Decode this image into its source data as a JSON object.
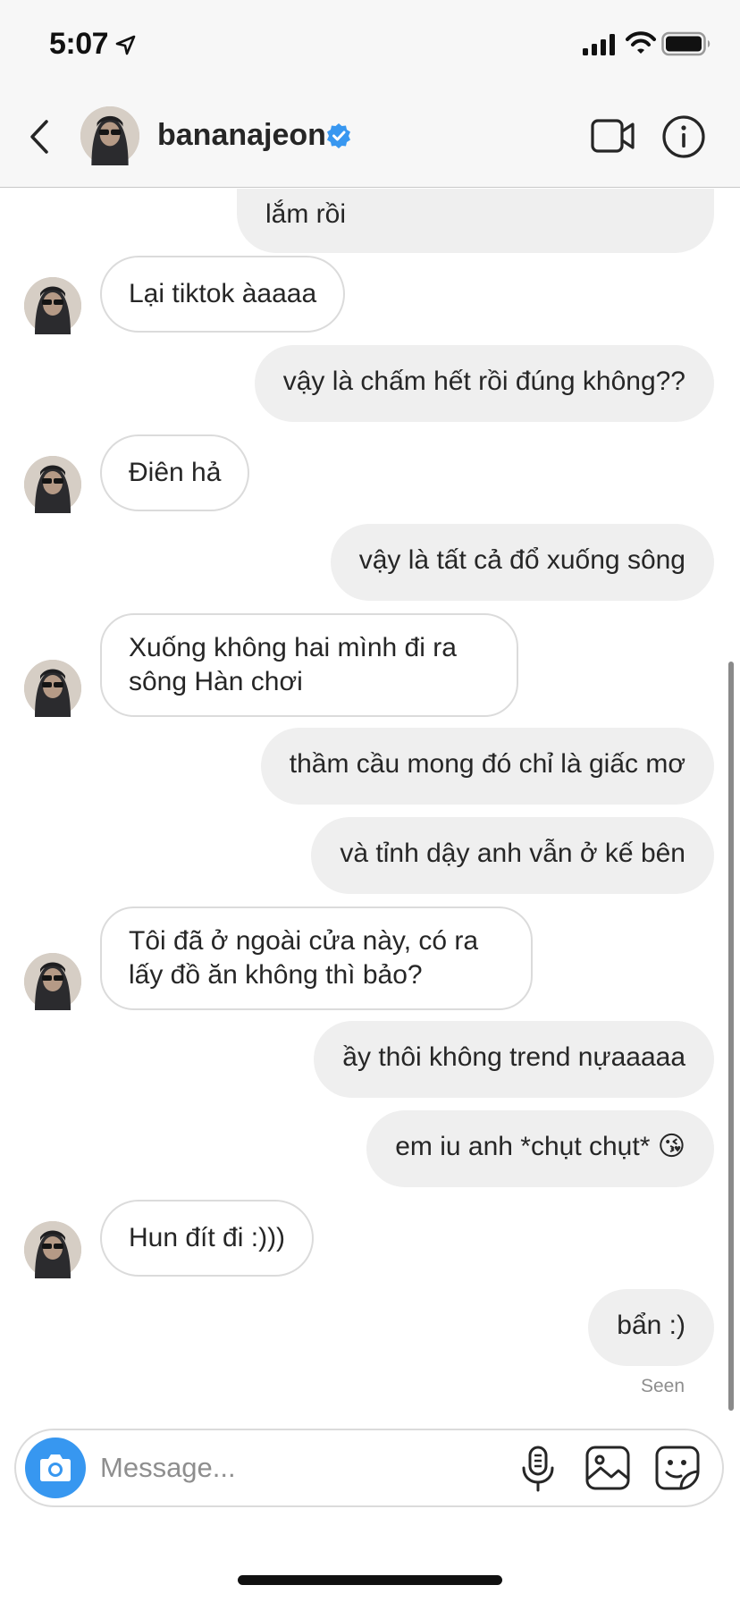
{
  "status_bar": {
    "time": "5:07"
  },
  "header": {
    "username": "bananajeon",
    "verified": true
  },
  "messages": [
    {
      "side": "sent",
      "text": "lắm rồi"
    },
    {
      "side": "received",
      "text": "Lại tiktok àaaaa"
    },
    {
      "side": "sent",
      "text": "vậy là chấm hết rồi đúng không??"
    },
    {
      "side": "received",
      "text": "Điên hả"
    },
    {
      "side": "sent",
      "text": "vậy là tất cả đổ xuống sông"
    },
    {
      "side": "received",
      "line1": "Xuống không hai mình đi ra",
      "line2": "sông Hàn chơi"
    },
    {
      "side": "sent",
      "text": "thầm cầu mong đó chỉ là giấc mơ"
    },
    {
      "side": "sent",
      "text": "và tỉnh dậy anh vẫn ở kế bên"
    },
    {
      "side": "received",
      "line1": "Tôi đã ở ngoài cửa này, có ra",
      "line2": "lấy đồ ăn không thì bảo?"
    },
    {
      "side": "sent",
      "text": "ầy thôi không trend nựaaaaa"
    },
    {
      "side": "sent",
      "text": "em iu anh *chụt chụt* 😘"
    },
    {
      "side": "received",
      "text": "Hun đít đi :)))"
    },
    {
      "side": "sent",
      "text": "bẩn :)"
    }
  ],
  "seen_label": "Seen",
  "composer": {
    "placeholder": "Message..."
  },
  "colors": {
    "accent": "#3797f0",
    "sent_bubble": "#efefef",
    "received_border": "#dbdbdb",
    "verified": "#3897f0"
  },
  "icons": {
    "status": [
      "location-arrow-icon",
      "signal-icon",
      "wifi-icon",
      "battery-icon"
    ],
    "header": [
      "back-arrow-icon",
      "video-camera-icon",
      "info-icon",
      "verified-badge-icon"
    ],
    "composer": [
      "camera-icon",
      "microphone-icon",
      "gallery-icon",
      "sticker-icon"
    ]
  }
}
